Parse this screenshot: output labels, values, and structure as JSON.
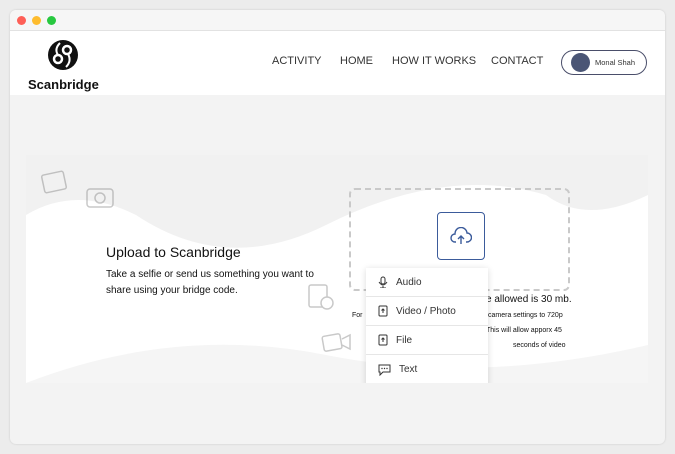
{
  "window": {
    "controls": [
      "close",
      "minimize",
      "maximize"
    ],
    "colors": {
      "close": "#fe5f57",
      "minimize": "#febc2e",
      "maximize": "#28c840"
    }
  },
  "header": {
    "logo_text": "Scanbridge",
    "nav": [
      "ACTIVITY",
      "HOME",
      "HOW IT WORKS",
      "CONTACT"
    ],
    "user_name": "Monal Shah"
  },
  "main": {
    "title": "Upload to Scanbridge",
    "description": "Take a selfie or send us something you want to share using your bridge code.",
    "info_line1": "e allowed is 30 mb.",
    "info_prefix": "For",
    "info_line2": "camera settings to 720p",
    "info_line3": "This will allow apporx 45",
    "info_line4": "seconds of video",
    "upload_icon": "cloud-upload-icon",
    "accent": "#3b5b9b"
  },
  "menu": {
    "items": [
      {
        "label": "Audio",
        "icon": "microphone-icon"
      },
      {
        "label": "Video / Photo",
        "icon": "upload-file-icon"
      },
      {
        "label": "File",
        "icon": "upload-file-icon"
      },
      {
        "label": "Text",
        "icon": "chat-icon"
      }
    ]
  }
}
